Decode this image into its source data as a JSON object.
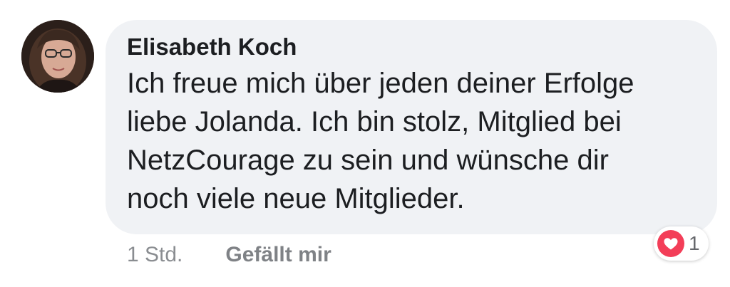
{
  "comment": {
    "author": "Elisabeth Koch",
    "text": "Ich freue mich über jeden deiner Erfolge\nliebe Jolanda. Ich bin stolz, Mitglied bei\nNetzCourage zu sein und wünsche dir\nnoch viele neue Mitglieder.",
    "time": "1 Std.",
    "like_label": "Gefällt mir",
    "reactions": {
      "icon": "heart-icon",
      "count": "1"
    }
  },
  "colors": {
    "bubble": "#f0f2f5",
    "text": "#1c1e21",
    "meta": "#8a8d91",
    "love": "#f33e58"
  }
}
